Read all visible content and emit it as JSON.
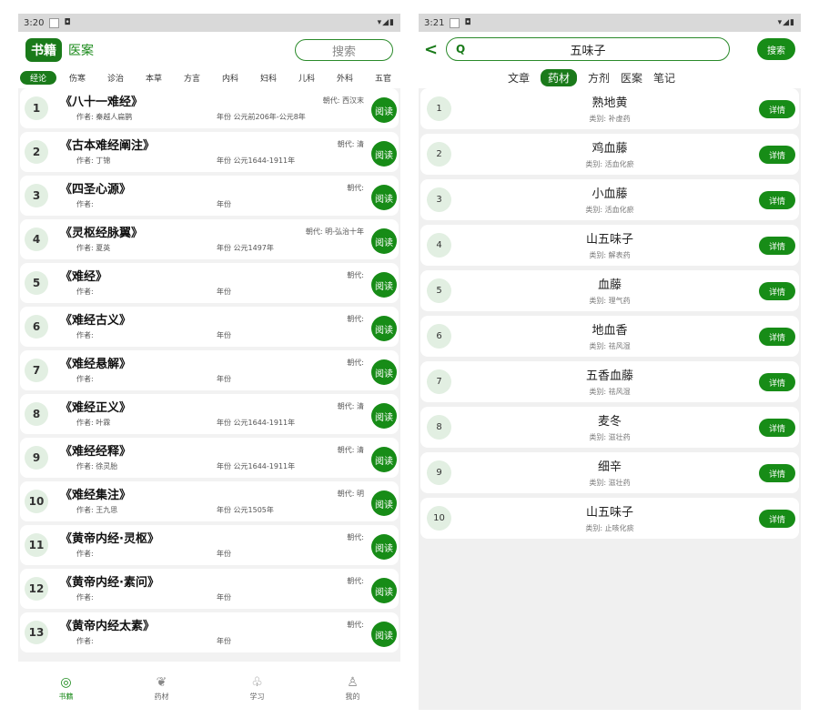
{
  "left": {
    "status": {
      "time": "3:20",
      "sd": "◘",
      "icons": "▾◢▮"
    },
    "header": {
      "tab_books": "书籍",
      "tab_cases": "医案",
      "search_placeholder": "搜索"
    },
    "categories": [
      "经论",
      "伤寒",
      "诊治",
      "本草",
      "方言",
      "内科",
      "妇科",
      "儿科",
      "外科",
      "五官"
    ],
    "read_label": "阅读",
    "books": [
      {
        "n": "1",
        "title": "《八十一难经》",
        "author": "作者: 秦越人扁鹊",
        "year": "年份 公元前206年-公元8年",
        "dynasty": "朝代: 西汉末"
      },
      {
        "n": "2",
        "title": "《古本难经阐注》",
        "author": "作者: 丁锦",
        "year": "年份 公元1644-1911年",
        "dynasty": "朝代: 清"
      },
      {
        "n": "3",
        "title": "《四圣心源》",
        "author": "作者:",
        "year": "年份",
        "dynasty": "朝代:"
      },
      {
        "n": "4",
        "title": "《灵枢经脉翼》",
        "author": "作者: 夏英",
        "year": "年份 公元1497年",
        "dynasty": "朝代: 明-弘治十年"
      },
      {
        "n": "5",
        "title": "《难经》",
        "author": "作者:",
        "year": "年份",
        "dynasty": "朝代:"
      },
      {
        "n": "6",
        "title": "《难经古义》",
        "author": "作者:",
        "year": "年份",
        "dynasty": "朝代:"
      },
      {
        "n": "7",
        "title": "《难经悬解》",
        "author": "作者:",
        "year": "年份",
        "dynasty": "朝代:"
      },
      {
        "n": "8",
        "title": "《难经正义》",
        "author": "作者: 叶霖",
        "year": "年份 公元1644-1911年",
        "dynasty": "朝代: 清"
      },
      {
        "n": "9",
        "title": "《难经经释》",
        "author": "作者: 徐灵胎",
        "year": "年份 公元1644-1911年",
        "dynasty": "朝代: 清"
      },
      {
        "n": "10",
        "title": "《难经集注》",
        "author": "作者: 王九思",
        "year": "年份 公元1505年",
        "dynasty": "朝代: 明"
      },
      {
        "n": "11",
        "title": "《黄帝内经·灵枢》",
        "author": "作者:",
        "year": "年份",
        "dynasty": "朝代:"
      },
      {
        "n": "12",
        "title": "《黄帝内经·素问》",
        "author": "作者:",
        "year": "年份",
        "dynasty": "朝代:"
      },
      {
        "n": "13",
        "title": "《黄帝内经太素》",
        "author": "作者:",
        "year": "年份",
        "dynasty": "朝代:"
      }
    ],
    "nav": [
      {
        "icon": "◎",
        "label": "书籍",
        "name": "book-icon"
      },
      {
        "icon": "❦",
        "label": "药材",
        "name": "herb-leaf-icon"
      },
      {
        "icon": "♧",
        "label": "学习",
        "name": "study-icon"
      },
      {
        "icon": "♙",
        "label": "我的",
        "name": "profile-icon"
      }
    ]
  },
  "right": {
    "status": {
      "time": "3:21",
      "sd": "◘",
      "icons": "▾◢▮"
    },
    "header": {
      "back": "<",
      "search_icon": "Q",
      "query": "五味子",
      "search_button": "搜索"
    },
    "tabs": [
      "文章",
      "药材",
      "方剂",
      "医案",
      "笔记"
    ],
    "detail_label": "详情",
    "herbs": [
      {
        "n": "1",
        "name": "熟地黄",
        "category": "类别: 补虚药"
      },
      {
        "n": "2",
        "name": "鸡血藤",
        "category": "类别: 活血化瘀"
      },
      {
        "n": "3",
        "name": "小血藤",
        "category": "类别: 活血化瘀"
      },
      {
        "n": "4",
        "name": "山五味子",
        "category": "类别: 解表药"
      },
      {
        "n": "5",
        "name": "血藤",
        "category": "类别: 理气药"
      },
      {
        "n": "6",
        "name": "地血香",
        "category": "类别: 祛风湿"
      },
      {
        "n": "7",
        "name": "五香血藤",
        "category": "类别: 祛风湿"
      },
      {
        "n": "8",
        "name": "麦冬",
        "category": "类别: 滋壮药"
      },
      {
        "n": "9",
        "name": "细辛",
        "category": "类别: 滋壮药"
      },
      {
        "n": "10",
        "name": "山五味子",
        "category": "类别: 止咳化痰"
      }
    ]
  }
}
